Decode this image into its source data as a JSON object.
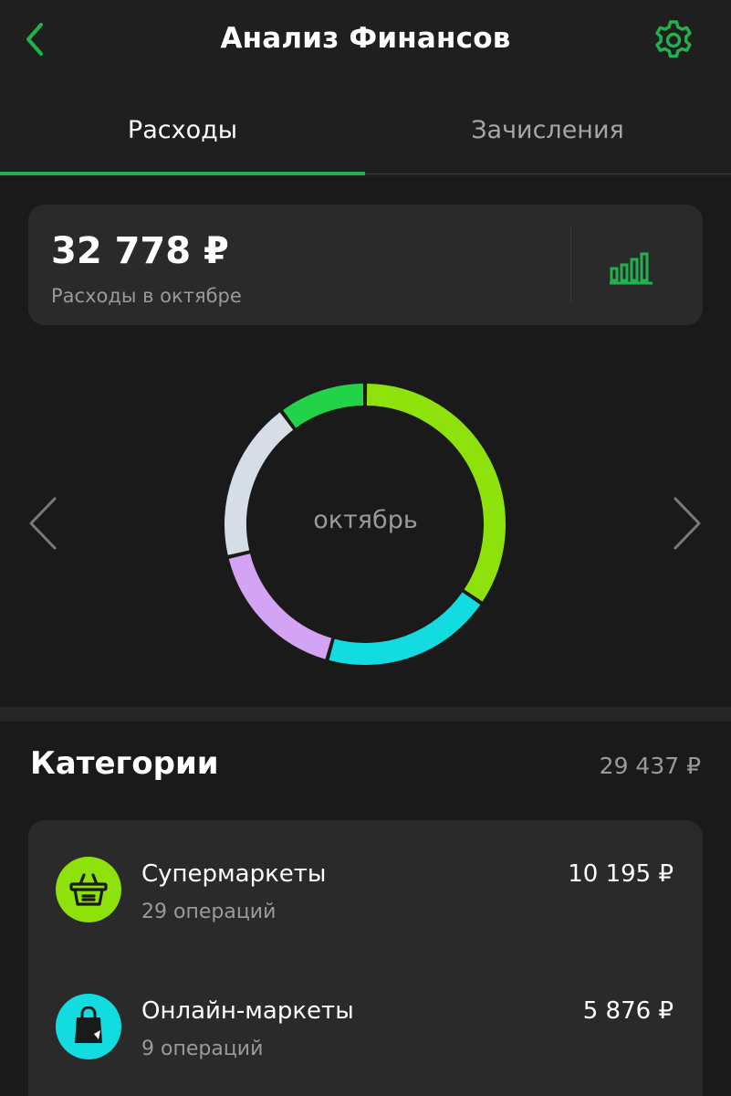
{
  "header": {
    "title": "Анализ Финансов",
    "back_icon": "chevron-left-icon",
    "settings_icon": "gear-icon"
  },
  "tabs": [
    {
      "label": "Расходы",
      "active": true
    },
    {
      "label": "Зачисления",
      "active": false
    }
  ],
  "summary": {
    "amount": "32 778 ₽",
    "caption": "Расходы в октябре",
    "chart_toggle_icon": "bar-chart-icon"
  },
  "chart": {
    "center_label": "октябрь",
    "prev_icon": "chevron-left-icon",
    "next_icon": "chevron-right-icon"
  },
  "chart_data": {
    "type": "pie",
    "categories": [
      "Супермаркеты",
      "Онлайн-маркеты",
      "",
      "",
      ""
    ],
    "values": [
      10195,
      5876,
      5000,
      5500,
      3000
    ],
    "colors": [
      "#8ee10b",
      "#12dcdf",
      "#d3a4f3",
      "#d5dde6",
      "#22d34a"
    ],
    "donut": true
  },
  "categories": {
    "title": "Категории",
    "total": "29 437 ₽",
    "items": [
      {
        "name": "Супермаркеты",
        "ops": "29 операций",
        "amount": "10 195 ₽",
        "icon": "basket-icon",
        "color": "#8ee10b"
      },
      {
        "name": "Онлайн-маркеты",
        "ops": "9 операций",
        "amount": "5 876 ₽",
        "icon": "shopping-bag-icon",
        "color": "#12dcdf"
      }
    ]
  },
  "colors": {
    "accent": "#22b14c",
    "background": "#1a1a1a",
    "card": "#2a2a2a",
    "muted_text": "#9a9a9a"
  }
}
